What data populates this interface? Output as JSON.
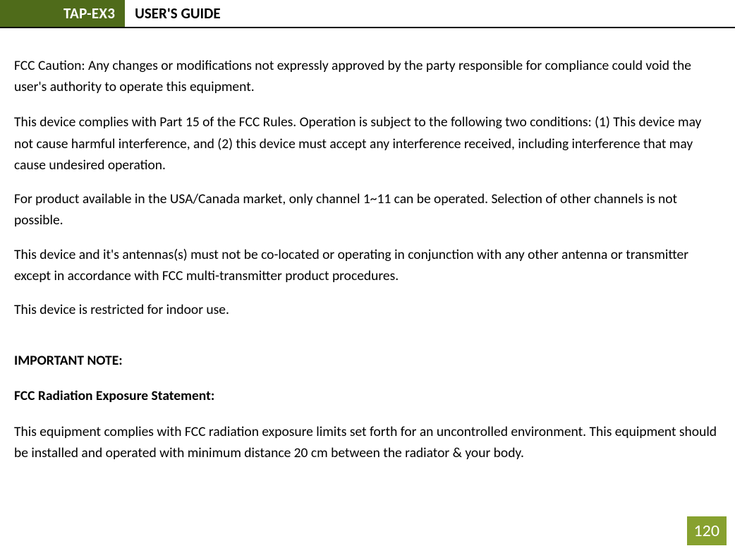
{
  "header": {
    "tab": "TAP-EX3",
    "title": "USER'S GUIDE"
  },
  "content": {
    "p1": "FCC Caution: Any changes or modifications not expressly approved by the party responsible for compliance could void the user's authority to operate this equipment.",
    "p2": "This device complies with Part 15 of the FCC Rules. Operation is subject to the following two conditions: (1) This device may not cause harmful interference, and (2) this device must accept any interference received, including interference that may cause undesired operation.",
    "p3": "For product available in the USA/Canada market, only channel 1~11 can be operated. Selection of other channels is not possible.",
    "p4": "This device and it's antennas(s) must not be co-located or operating in conjunction with any other antenna or transmitter except in accordance with FCC multi-transmitter product procedures.",
    "p5": "This device is restricted for indoor use.",
    "h1": "IMPORTANT NOTE:",
    "h2": "FCC Radiation Exposure Statement:",
    "p6": "This equipment complies with FCC radiation exposure limits set forth for an uncontrolled environment. This equipment should be installed and operated with minimum distance 20 cm between the radiator & your body."
  },
  "page_number": "120",
  "colors": {
    "header_bg": "#4f6b1a",
    "page_bg": "#87a12f"
  }
}
